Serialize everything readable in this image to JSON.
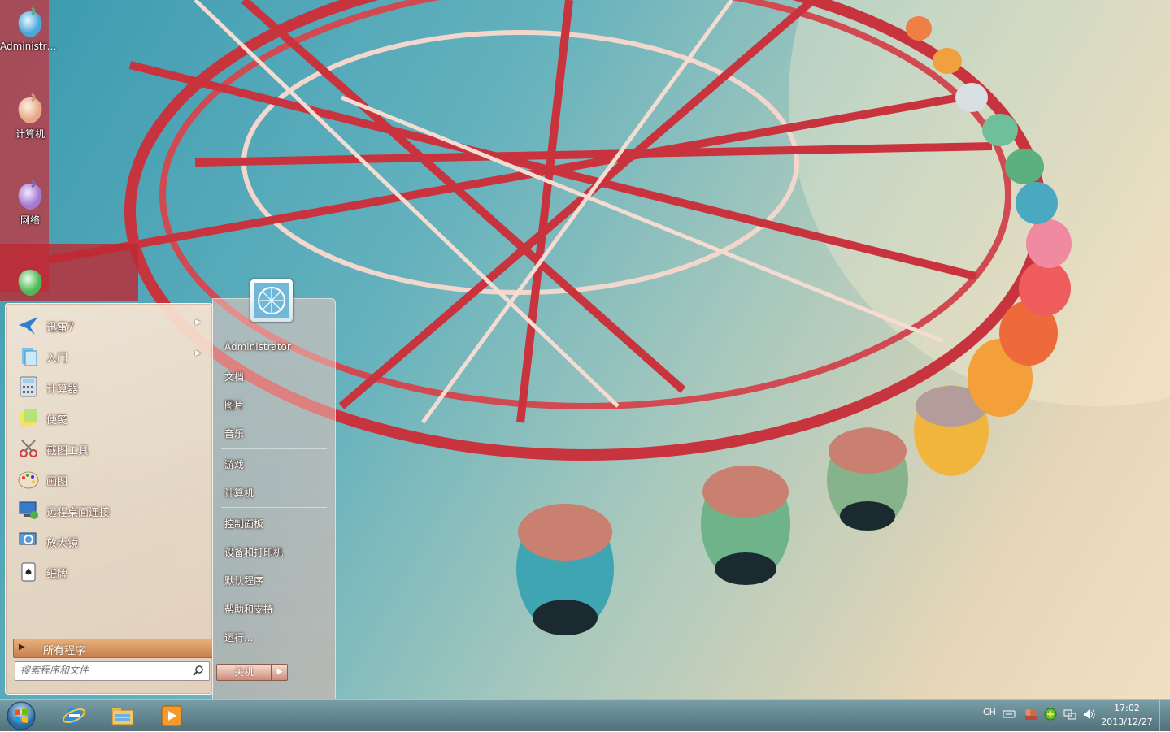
{
  "desktop": {
    "icons": [
      {
        "label": "Administra..."
      },
      {
        "label": "计算机"
      },
      {
        "label": "网络"
      },
      {
        "label": ""
      }
    ]
  },
  "start_menu": {
    "programs": [
      {
        "label": "迅雷7",
        "has_submenu": true
      },
      {
        "label": "入门",
        "has_submenu": true
      },
      {
        "label": "计算器",
        "has_submenu": false
      },
      {
        "label": "便笺",
        "has_submenu": false
      },
      {
        "label": "截图工具",
        "has_submenu": false
      },
      {
        "label": "画图",
        "has_submenu": false
      },
      {
        "label": "远程桌面连接",
        "has_submenu": false
      },
      {
        "label": "放大镜",
        "has_submenu": false
      },
      {
        "label": "纸牌",
        "has_submenu": false
      }
    ],
    "all_programs_label": "所有程序",
    "search_placeholder": "搜索程序和文件",
    "right_items": {
      "user": "Administrator",
      "documents": "文档",
      "pictures": "图片",
      "music": "音乐",
      "games": "游戏",
      "computer": "计算机",
      "control_panel": "控制面板",
      "devices_printers": "设备和打印机",
      "default_programs": "默认程序",
      "help_support": "帮助和支持",
      "run": "运行..."
    },
    "shutdown_label": "关机"
  },
  "taskbar": {
    "pinned": [
      "internet-explorer",
      "windows-explorer",
      "media-player"
    ],
    "tray": {
      "language": "CH",
      "time": "17:02",
      "date": "2013/12/27"
    }
  }
}
